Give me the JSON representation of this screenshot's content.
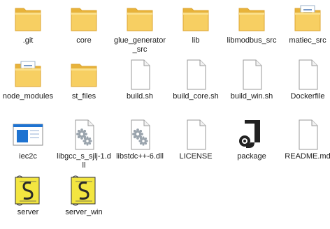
{
  "window": {
    "view": "Large icons"
  },
  "items": [
    {
      "name": ".git",
      "type": "folder",
      "icon": "folder-icon"
    },
    {
      "name": "core",
      "type": "folder",
      "icon": "folder-icon"
    },
    {
      "name": "glue_generator_src",
      "type": "folder",
      "icon": "folder-icon"
    },
    {
      "name": "lib",
      "type": "folder",
      "icon": "folder-icon"
    },
    {
      "name": "libmodbus_src",
      "type": "folder",
      "icon": "folder-icon"
    },
    {
      "name": "matiec_src",
      "type": "folder",
      "icon": "folder-docs-icon"
    },
    {
      "name": "node_modules",
      "type": "folder",
      "icon": "folder-docs-icon"
    },
    {
      "name": "st_files",
      "type": "folder",
      "icon": "folder-icon"
    },
    {
      "name": "build.sh",
      "type": "file",
      "icon": "file-icon"
    },
    {
      "name": "build_core.sh",
      "type": "file",
      "icon": "file-icon"
    },
    {
      "name": "build_win.sh",
      "type": "file",
      "icon": "file-icon"
    },
    {
      "name": "Dockerfile",
      "type": "file",
      "icon": "file-icon"
    },
    {
      "name": "iec2c",
      "type": "exe",
      "icon": "application-icon"
    },
    {
      "name": "libgcc_s_sjlj-1.dll",
      "type": "dll",
      "icon": "dll-gear-icon"
    },
    {
      "name": "libstdc++-6.dll",
      "type": "dll",
      "icon": "dll-gear-icon"
    },
    {
      "name": "LICENSE",
      "type": "file",
      "icon": "file-icon"
    },
    {
      "name": "package",
      "type": "app",
      "icon": "package-app-icon"
    },
    {
      "name": "README.md",
      "type": "file",
      "icon": "file-icon"
    },
    {
      "name": "server",
      "type": "script",
      "icon": "script-icon"
    },
    {
      "name": "server_win",
      "type": "script",
      "icon": "script-icon"
    }
  ],
  "colors": {
    "folder_front": "#f7cf62",
    "folder_back": "#e8b33a",
    "folder_tab": "#dca532",
    "file_border": "#9a9a9a",
    "exe_blue": "#1e73d1",
    "gear": "#9aa4ad",
    "script_yellow": "#f3e640",
    "package_dark": "#222222"
  }
}
